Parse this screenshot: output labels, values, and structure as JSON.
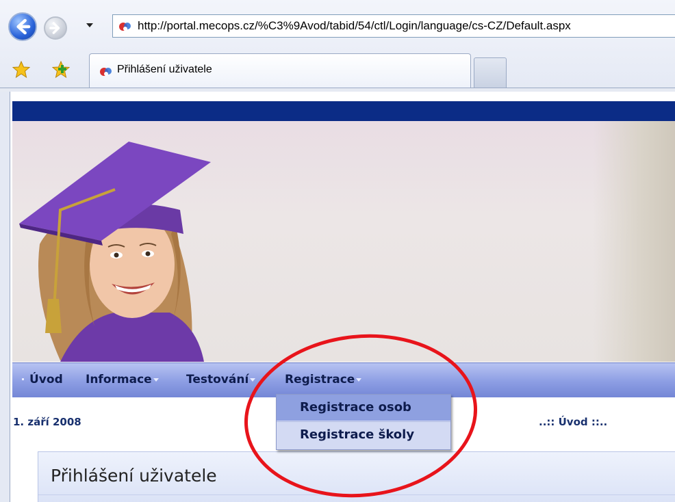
{
  "browser": {
    "address": "http://portal.mecops.cz/%C3%9Avod/tabid/54/ctl/Login/language/cs-CZ/Default.aspx",
    "tab_title": "Přihlášení uživatele",
    "icons": [
      "back-arrow-icon",
      "forward-arrow-icon",
      "recent-pages-dropdown-icon",
      "site-favicon",
      "favorites-star-icon",
      "add-favorites-icon"
    ]
  },
  "menu": {
    "items": [
      {
        "label": "Úvod",
        "has_submenu": false
      },
      {
        "label": "Informace",
        "has_submenu": true
      },
      {
        "label": "Testování",
        "has_submenu": true
      },
      {
        "label": "Registrace",
        "has_submenu": true
      }
    ],
    "dropdown": {
      "parent": "Registrace",
      "items": [
        "Registrace osob",
        "Registrace školy"
      ],
      "highlighted": "Registrace osob"
    }
  },
  "page": {
    "date": "1. září 2008",
    "breadcrumb": "..:: Úvod ::..",
    "login_title": "Přihlášení uživatele"
  },
  "colors": {
    "topbar": "#0b2c86",
    "menubar": "#8c9de3",
    "highlight": "#8ea0e0",
    "annotation": "#e8141b"
  }
}
